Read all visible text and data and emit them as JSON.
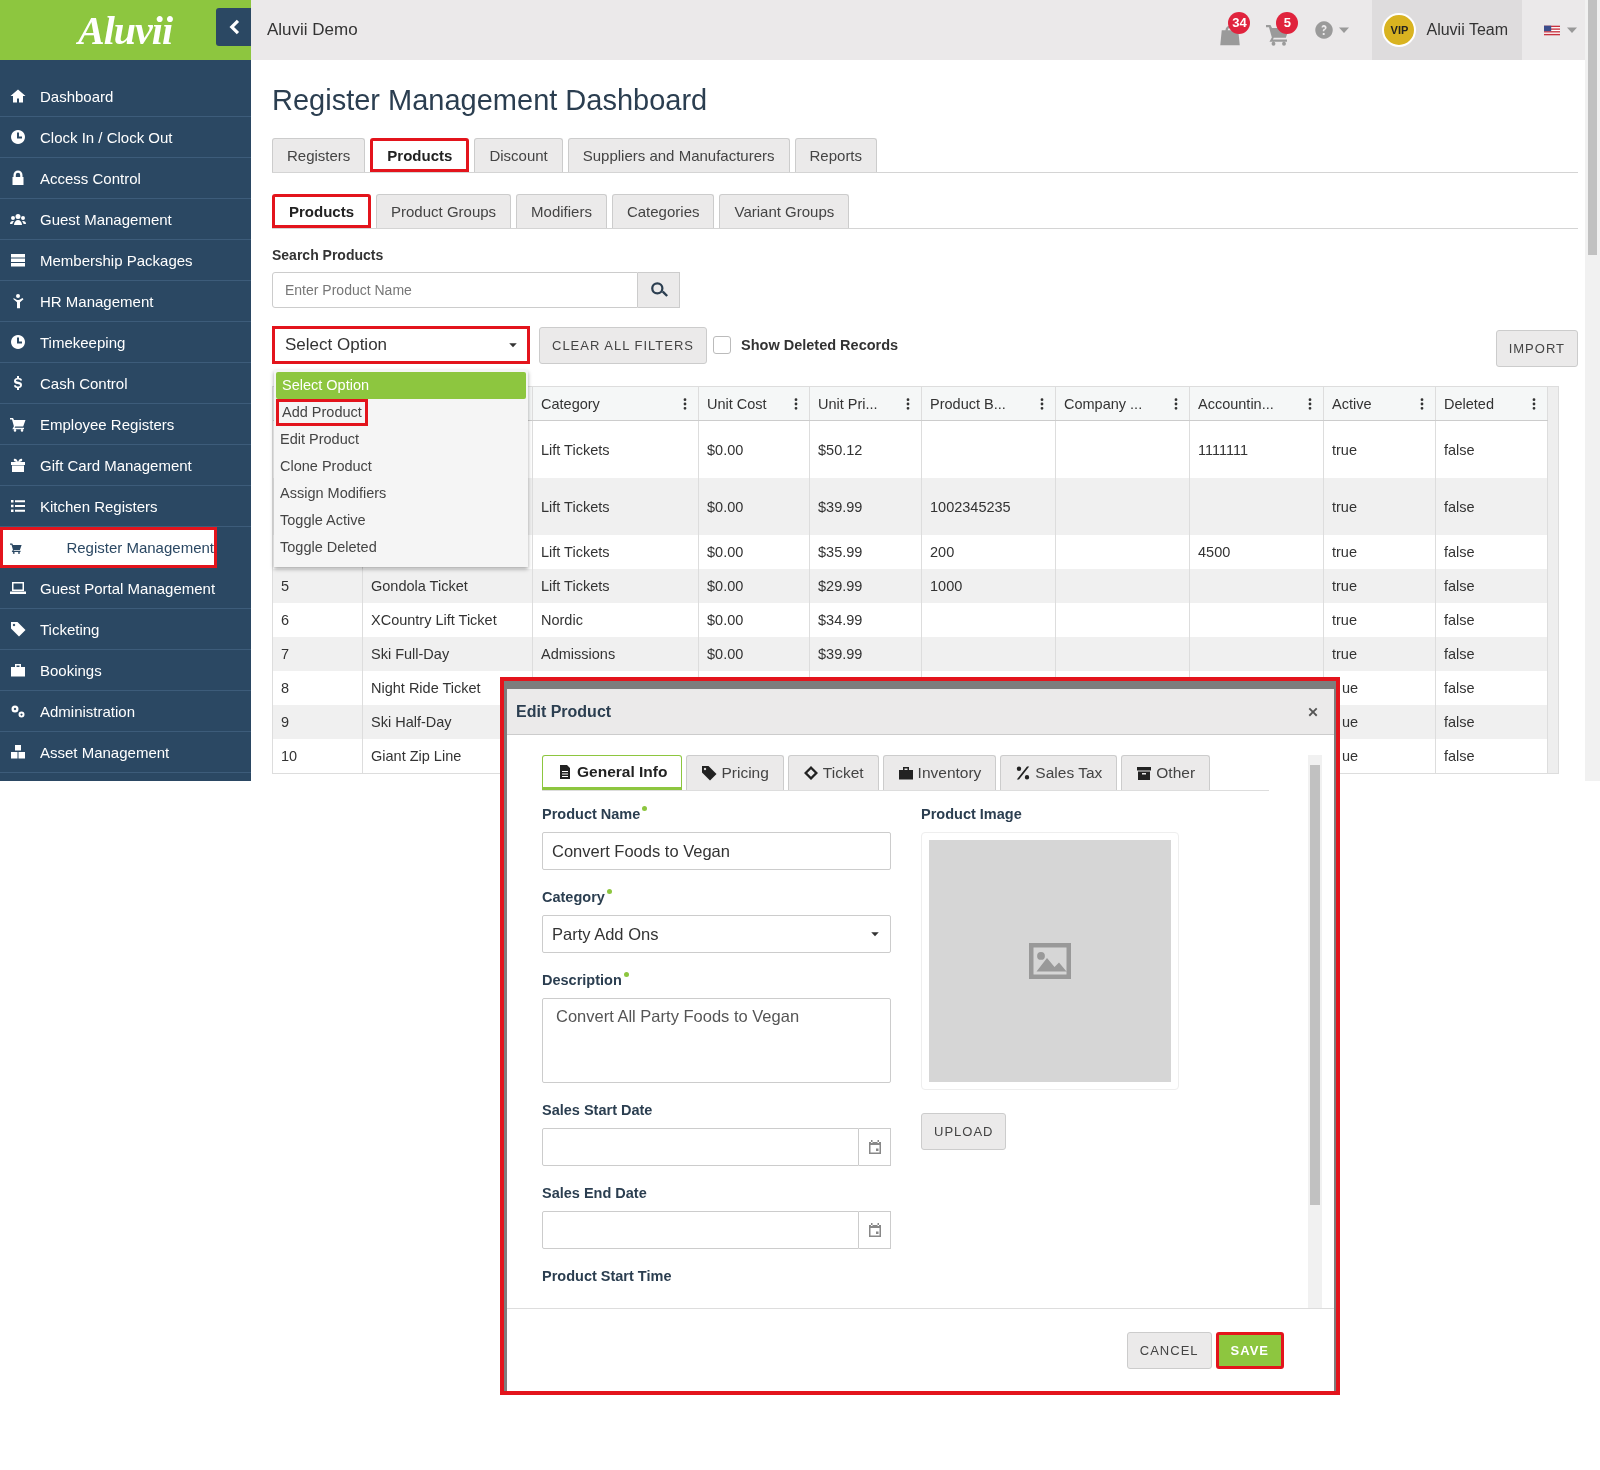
{
  "app": {
    "logo": "Aluvii",
    "org": "Aluvii Demo"
  },
  "topbar": {
    "notifications": [
      {
        "kind": "bag",
        "count": "34"
      },
      {
        "kind": "cart",
        "count": "5"
      }
    ],
    "user": {
      "badge": "VIP",
      "name": "Aluvii Team"
    }
  },
  "sidebar": {
    "items": [
      {
        "label": "Dashboard",
        "selected": false,
        "highlighted": false
      },
      {
        "label": "Clock In / Clock Out",
        "selected": false,
        "highlighted": false
      },
      {
        "label": "Access Control",
        "selected": false,
        "highlighted": false
      },
      {
        "label": "Guest Management",
        "selected": false,
        "highlighted": false
      },
      {
        "label": "Membership Packages",
        "selected": false,
        "highlighted": false
      },
      {
        "label": "HR Management",
        "selected": false,
        "highlighted": false
      },
      {
        "label": "Timekeeping",
        "selected": false,
        "highlighted": false
      },
      {
        "label": "Cash Control",
        "selected": false,
        "highlighted": false
      },
      {
        "label": "Employee Registers",
        "selected": false,
        "highlighted": false
      },
      {
        "label": "Gift Card Management",
        "selected": false,
        "highlighted": false
      },
      {
        "label": "Kitchen Registers",
        "selected": false,
        "highlighted": false
      },
      {
        "label": "Register Management",
        "selected": true,
        "highlighted": true
      },
      {
        "label": "Guest Portal Management",
        "selected": false,
        "highlighted": false
      },
      {
        "label": "Ticketing",
        "selected": false,
        "highlighted": false
      },
      {
        "label": "Bookings",
        "selected": false,
        "highlighted": false
      },
      {
        "label": "Administration",
        "selected": false,
        "highlighted": false
      },
      {
        "label": "Asset Management",
        "selected": false,
        "highlighted": false
      }
    ]
  },
  "page": {
    "title": "Register Management Dashboard"
  },
  "tabs": [
    {
      "label": "Registers",
      "selected": false,
      "highlighted": false
    },
    {
      "label": "Products",
      "selected": true,
      "highlighted": true
    },
    {
      "label": "Discount",
      "selected": false,
      "highlighted": false
    },
    {
      "label": "Suppliers and Manufacturers",
      "selected": false,
      "highlighted": false
    },
    {
      "label": "Reports",
      "selected": false,
      "highlighted": false
    }
  ],
  "subtabs": [
    {
      "label": "Products",
      "selected": true,
      "highlighted": true
    },
    {
      "label": "Product Groups",
      "selected": false,
      "highlighted": false
    },
    {
      "label": "Modifiers",
      "selected": false,
      "highlighted": false
    },
    {
      "label": "Categories",
      "selected": false,
      "highlighted": false
    },
    {
      "label": "Variant Groups",
      "selected": false,
      "highlighted": false
    }
  ],
  "search": {
    "label": "Search Products",
    "placeholder": "Enter Product Name"
  },
  "action_select": {
    "value": "Select Option",
    "highlighted": true,
    "expanded": true,
    "options": [
      {
        "label": "Select Option",
        "selected": true,
        "highlighted": false
      },
      {
        "label": "Add Product",
        "selected": false,
        "highlighted": true
      },
      {
        "label": "Edit Product",
        "selected": false,
        "highlighted": false
      },
      {
        "label": "Clone Product",
        "selected": false,
        "highlighted": false
      },
      {
        "label": "Assign Modifiers",
        "selected": false,
        "highlighted": false
      },
      {
        "label": "Toggle Active",
        "selected": false,
        "highlighted": false
      },
      {
        "label": "Toggle Deleted",
        "selected": false,
        "highlighted": false
      }
    ]
  },
  "clear_button": "CLEAR ALL FILTERS",
  "show_deleted": {
    "label": "Show Deleted Records",
    "checked": false
  },
  "import_button": "IMPORT",
  "table": {
    "columns": [
      "",
      "",
      "Category",
      "Unit Cost",
      "Unit Pri...",
      "Product B...",
      "Company ...",
      "Accountin...",
      "Active",
      "Deleted"
    ],
    "rows": [
      [
        null,
        null,
        "Lift Tickets",
        "$0.00",
        "$50.12",
        null,
        null,
        "1111111",
        "true",
        "false"
      ],
      [
        null,
        null,
        "Lift Tickets",
        "$0.00",
        "$39.99",
        "1002345235",
        null,
        null,
        "true",
        "false"
      ],
      [
        null,
        null,
        "Lift Tickets",
        "$0.00",
        "$35.99",
        "200",
        null,
        "4500",
        "true",
        "false"
      ],
      [
        "5",
        "Gondola Ticket",
        "Lift Tickets",
        "$0.00",
        "$29.99",
        "1000",
        null,
        null,
        "true",
        "false"
      ],
      [
        "6",
        "XCountry Lift Ticket",
        "Nordic",
        "$0.00",
        "$34.99",
        null,
        null,
        null,
        "true",
        "false"
      ],
      [
        "7",
        "Ski Full-Day",
        "Admissions",
        "$0.00",
        "$39.99",
        null,
        null,
        null,
        "true",
        "false"
      ],
      [
        "8",
        "Night Ride Ticket",
        null,
        null,
        null,
        null,
        null,
        null,
        "ue",
        "false"
      ],
      [
        "9",
        "Ski Half-Day",
        null,
        null,
        null,
        null,
        null,
        null,
        "ue",
        "false"
      ],
      [
        "10",
        "Giant Zip Line",
        null,
        null,
        null,
        null,
        null,
        null,
        "ue",
        "false"
      ]
    ]
  },
  "modal": {
    "title": "Edit Product",
    "highlighted": true,
    "tabs": [
      {
        "label": "General Info",
        "selected": true
      },
      {
        "label": "Pricing",
        "selected": false
      },
      {
        "label": "Ticket",
        "selected": false
      },
      {
        "label": "Inventory",
        "selected": false
      },
      {
        "label": "Sales Tax",
        "selected": false
      },
      {
        "label": "Other",
        "selected": false
      }
    ],
    "fields": [
      {
        "kind": "text",
        "label": "Product Name",
        "required": true,
        "value": "Convert Foods to Vegan"
      },
      {
        "kind": "select",
        "label": "Category",
        "required": true,
        "value": "Party Add Ons"
      },
      {
        "kind": "textarea",
        "label": "Description",
        "required": true,
        "value": "Convert All Party Foods to Vegan"
      },
      {
        "kind": "date",
        "label": "Sales Start Date",
        "required": false
      },
      {
        "kind": "date",
        "label": "Sales End Date",
        "required": false
      },
      {
        "kind": "cut",
        "label": "Product Start Time",
        "required": false
      }
    ],
    "image": {
      "label": "Product Image",
      "upload": "UPLOAD"
    },
    "buttons": [
      {
        "kind": "cancel",
        "label": "CANCEL",
        "highlighted": false
      },
      {
        "kind": "save",
        "label": "SAVE",
        "highlighted": true
      }
    ]
  }
}
